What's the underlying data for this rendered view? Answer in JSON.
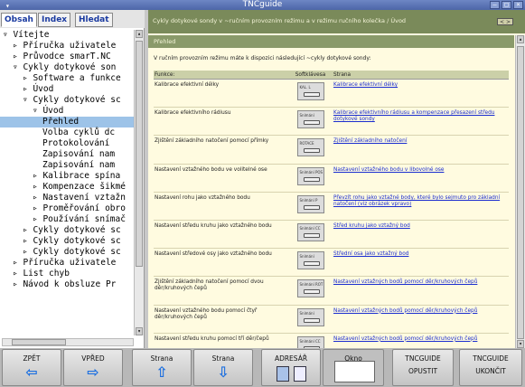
{
  "window": {
    "title": "TNCguide"
  },
  "left_pane": {
    "tabs": [
      "Obsah",
      "Index",
      "Hledat"
    ],
    "tree": [
      {
        "text": "▿ Vítejte",
        "indent": 0,
        "selected": false
      },
      {
        "text": "▹ Příručka uživatele",
        "indent": 1,
        "selected": false
      },
      {
        "text": "▹ Průvodce smarT.NC",
        "indent": 1,
        "selected": false
      },
      {
        "text": "▿ Cykly dotykové son",
        "indent": 1,
        "selected": false
      },
      {
        "text": "▹ Software a funkce",
        "indent": 2,
        "selected": false
      },
      {
        "text": "▹ Úvod",
        "indent": 2,
        "selected": false
      },
      {
        "text": "▿ Cykly dotykové sc",
        "indent": 2,
        "selected": false
      },
      {
        "text": "▿ Úvod",
        "indent": 3,
        "selected": false
      },
      {
        "text": "Přehled",
        "indent": 4,
        "selected": true
      },
      {
        "text": "Volba cyklů dc",
        "indent": 4,
        "selected": false
      },
      {
        "text": "Protokolování",
        "indent": 4,
        "selected": false
      },
      {
        "text": "Zapisování nam",
        "indent": 4,
        "selected": false
      },
      {
        "text": "Zapisování nam",
        "indent": 4,
        "selected": false
      },
      {
        "text": "▹ Kalibrace spína",
        "indent": 3,
        "selected": false
      },
      {
        "text": "▹ Kompenzace šikmé",
        "indent": 3,
        "selected": false
      },
      {
        "text": "▹ Nastavení vztažn",
        "indent": 3,
        "selected": false
      },
      {
        "text": "▹ Proměřování obro",
        "indent": 3,
        "selected": false
      },
      {
        "text": "▹ Používání snímač",
        "indent": 3,
        "selected": false
      },
      {
        "text": "▹ Cykly dotykové sc",
        "indent": 2,
        "selected": false
      },
      {
        "text": "▹ Cykly dotykové sc",
        "indent": 2,
        "selected": false
      },
      {
        "text": "▹ Cykly dotykové sc",
        "indent": 2,
        "selected": false
      },
      {
        "text": "▹ Příručka uživatele",
        "indent": 1,
        "selected": false
      },
      {
        "text": "▹ List chyb",
        "indent": 1,
        "selected": false
      },
      {
        "text": "▹ Návod k obsluze Pr",
        "indent": 1,
        "selected": false
      }
    ]
  },
  "right_pane": {
    "breadcrumb": "Cykly dotykové sondy v ~ručním provozním režimu a v režimu ručního  kolečka / Úvod",
    "nav_button": "< >",
    "section_title": "Přehled",
    "intro": "V ručním provozním režimu máte k dispozici následující ~cykly dotykové sondy:",
    "table": {
      "headers": [
        "Funkce:",
        "Softklávesa",
        "Strana"
      ],
      "rows": [
        {
          "function": "Kalibrace efektivní délky",
          "softkey": "KAL. L",
          "page": "Kalibrace efektivní délky"
        },
        {
          "function": "Kalibrace efektivního rádiusu",
          "softkey": "Snímání",
          "page": "Kalibrace efektivního rádiusu a kompenzace přesazení středu dotykové sondy"
        },
        {
          "function": "Zjištění základního natočení pomocí přímky",
          "softkey": "ROTACE",
          "page": "Zjištění základního natočení"
        },
        {
          "function": "Nastavení vztažného bodu ve volitelné ose",
          "softkey": "Snímání POS",
          "page": "Nastavení vztažného bodu v libovolné ose"
        },
        {
          "function": "Nastavení rohu jako vztažného bodu",
          "softkey": "Snímání P",
          "page": "Převzít rohu jako vztažné body, které bylo sejmuto pro základní natočení (viz obrázek vpravo)"
        },
        {
          "function": "Nastavení středu kruhu jako vztažného bodu",
          "softkey": "Snímání CC",
          "page": "Střed kruhu jako vztažný bod"
        },
        {
          "function": "Nastavení středové osy jako vztažného bodu",
          "softkey": "Snímání",
          "page": "Střední osa jako vztažný bod"
        },
        {
          "function": "Zjištění základního natočení pomocí dvou děr/kruhových čepů",
          "softkey": "Snímání ROT",
          "page": "Nastavení vztažných bodů pomocí děr/kruhových čepů"
        },
        {
          "function": "Nastavení vztažného bodu pomocí čtyř děr/kruhových čepů",
          "softkey": "Snímání",
          "page": "Nastavení vztažných bodů pomocí děr/kruhových čepů"
        },
        {
          "function": "Nastavení středu kruhu pomocí tří děr/čepů",
          "softkey": "Snímání CC",
          "page": "Nastavení vztažných bodů pomocí děr/kruhových čepů"
        }
      ]
    }
  },
  "softkeys": [
    {
      "label": "ZPĚT",
      "icon": "arrow-left-icon",
      "glyph": "⇦"
    },
    {
      "label": "VPŘED",
      "icon": "arrow-right-icon",
      "glyph": "⇨"
    },
    {
      "label": "Strana",
      "icon": "arrow-up-icon",
      "glyph": "⇧"
    },
    {
      "label": "Strana",
      "icon": "arrow-down-icon",
      "glyph": "⇩"
    },
    {
      "label": "ADRESÁŘ",
      "icon": "directory-icon"
    },
    {
      "label": "Okno",
      "icon": "window-icon"
    },
    {
      "label": "TNCGUIDE",
      "label2": "OPUSTIT"
    },
    {
      "label": "TNCGUIDE",
      "label2": "UKONČIT"
    }
  ],
  "colors": {
    "title_bar": "#5a73b4",
    "selected_tree": "#9dc3e8",
    "breadcrumb_bg": "#7a8a5a",
    "link": "#1a2ccf",
    "icon_blue": "#1c6fe0"
  }
}
